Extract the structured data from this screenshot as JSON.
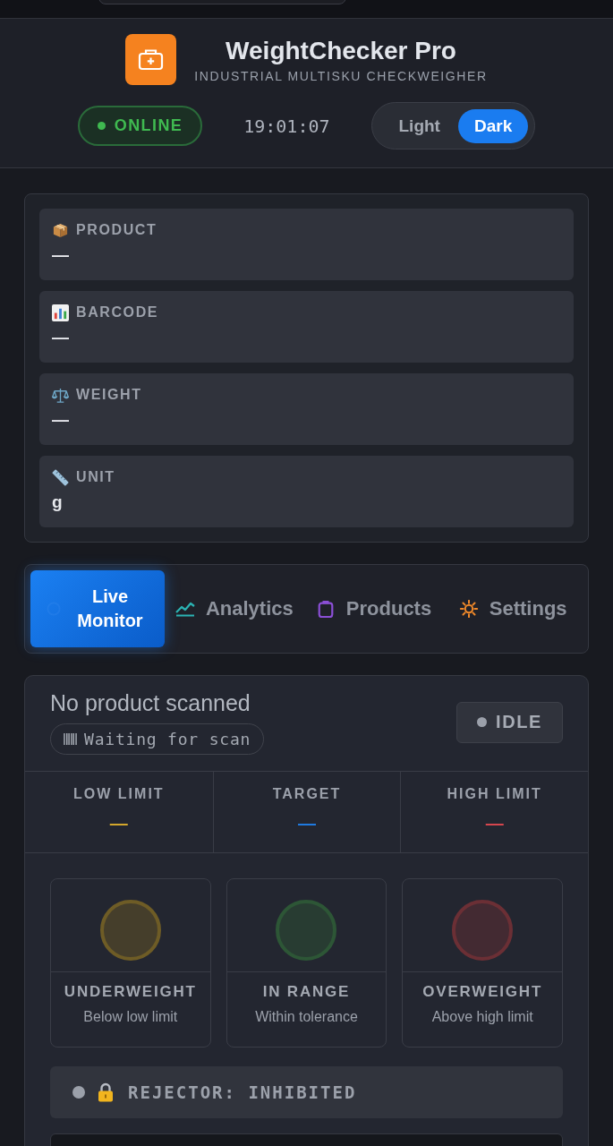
{
  "header": {
    "title": "WeightChecker Pro",
    "subtitle": "INDUSTRIAL MULTISKU CHECKWEIGHER",
    "connection": {
      "label": "ONLINE",
      "online": true
    },
    "clock": "19:01:07",
    "theme_toggle": [
      {
        "label": "Light",
        "selected": false
      },
      {
        "label": "Dark",
        "selected": true
      }
    ]
  },
  "product_fields": [
    {
      "label": "PRODUCT",
      "value": "—"
    },
    {
      "label": "BARCODE",
      "value": "—"
    },
    {
      "label": "WEIGHT",
      "value": "—"
    },
    {
      "label": "UNIT",
      "value": "g"
    }
  ],
  "tabs": [
    {
      "label": "Live Monitor",
      "selected": true
    },
    {
      "label": "Analytics",
      "selected": false
    },
    {
      "label": "Products",
      "selected": false
    },
    {
      "label": "Settings",
      "selected": false
    }
  ],
  "monitor": {
    "product_name": "No product scanned",
    "scan_status": "Waiting for scan",
    "state_badge": "IDLE",
    "limits": [
      {
        "label": "LOW LIMIT",
        "value": "—",
        "color": "#d4a72c"
      },
      {
        "label": "TARGET",
        "value": "—",
        "color": "#1f7ae0"
      },
      {
        "label": "HIGH LIMIT",
        "value": "—",
        "color": "#d5464e"
      }
    ],
    "indicators": [
      {
        "title": "UNDERWEIGHT",
        "description": "Below low limit",
        "color": "#6e5c26",
        "on": false
      },
      {
        "title": "IN RANGE",
        "description": "Within tolerance",
        "color": "#2d5636",
        "on": false
      },
      {
        "title": "OVERWEIGHT",
        "description": "Above high limit",
        "color": "#6b2f35",
        "on": false
      }
    ],
    "rejector": {
      "label": "REJECTOR: INHIBITED",
      "armed": false
    }
  }
}
